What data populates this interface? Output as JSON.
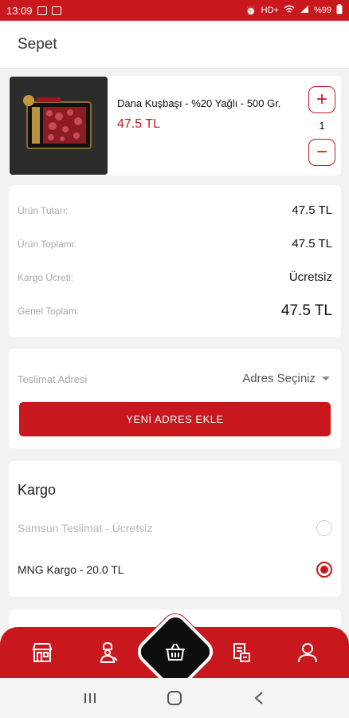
{
  "status_bar": {
    "time": "13:09",
    "network": "HD+",
    "battery": "%99"
  },
  "header": {
    "title": "Sepet"
  },
  "cart": {
    "item": {
      "name": "Dana Kuşbaşı - %20 Yağlı - 500 Gr.",
      "price": "47.5 TL",
      "quantity": "1",
      "plus_symbol": "+",
      "minus_symbol": "−"
    }
  },
  "totals": [
    {
      "label": "Ürün Tutarı:",
      "value": "47.5 TL"
    },
    {
      "label": "Ürün Toplamı:",
      "value": "47.5 TL"
    },
    {
      "label": "Kargo Ücreti:",
      "value": "Ücretsiz"
    },
    {
      "label": "Genel Toplam:",
      "value": "47.5 TL"
    }
  ],
  "address": {
    "label": "Teslimat Adresi",
    "select_value": "Adres Seçiniz",
    "add_button": "YENİ ADRES EKLE"
  },
  "cargo": {
    "title": "Kargo",
    "options": [
      {
        "label": "Samsun Teslimat - Ücretsiz",
        "selected": false,
        "enabled": false
      },
      {
        "label": "MNG Kargo - 20.0 TL",
        "selected": true,
        "enabled": true
      }
    ]
  },
  "colors": {
    "accent": "#c8171d",
    "basket_bg": "#0d0d0d",
    "muted_text": "#a8a8a8"
  },
  "icons": {
    "nav": [
      "store-icon",
      "chef-icon",
      "basket-icon",
      "receipt-icon",
      "user-icon"
    ],
    "system": [
      "recent-apps-icon",
      "home-icon",
      "back-icon"
    ]
  }
}
